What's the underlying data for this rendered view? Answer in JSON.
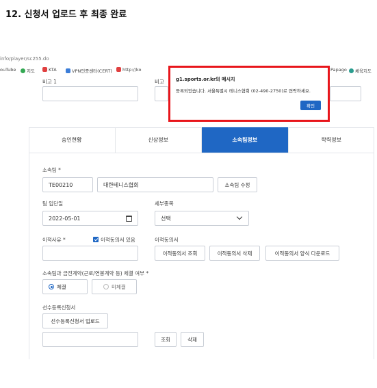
{
  "heading": "12. 신청서 업로드 후 최종 완료",
  "browser": {
    "url": "info/player/sc255.do",
    "bookmarks": [
      {
        "label": "ouTube",
        "color": "#ffffff"
      },
      {
        "label": "지도",
        "color": "#34a853"
      },
      {
        "label": "KTA",
        "color": "#e04040"
      },
      {
        "label": "VPN인증센터(CERT)",
        "color": "#3b7dd8"
      },
      {
        "label": "http://ko",
        "color": "#e04040"
      },
      {
        "label": "Papago",
        "color": "#ffffff"
      },
      {
        "label": "체육지도",
        "color": "#2a9d8f"
      }
    ]
  },
  "form": {
    "top_label_1": "비고 1",
    "top_label_2": "비고",
    "tabs": [
      "승인현황",
      "신상정보",
      "소속팀정보",
      "학력정보"
    ],
    "team_label": "소속팀 *",
    "team_code": "TE00210",
    "team_name": "대한테니스협회",
    "team_edit_button": "소속팀 수정",
    "join_date_label": "팀 입단일",
    "join_date": "2022-05-01",
    "detail_event_label": "세부종목",
    "detail_event_value": "선택",
    "transfer_reason_label": "이적사유 *",
    "transfer_consent_check": "이적동의서 있음",
    "transfer_doc_label": "이적동의서",
    "transfer_view_button": "이적동의서 조회",
    "transfer_delete_button": "이적동의서 삭제",
    "transfer_download_button": "이적동의서 양식 다운로드",
    "contract_label": "소속팀과 금전계약(근로/연봉계약 등) 체결 여부 *",
    "contract_yes": "체결",
    "contract_no": "미체결",
    "application_label": "선수등록신청서",
    "application_upload_button": "선수등록신청서 업로드",
    "application_view_button": "조회",
    "application_delete_button": "삭제"
  },
  "dialog": {
    "title": "g1.sports.or.kr의 메시지",
    "message": "등록되었습니다. 서울특별시 테니스협회 (02-490-2750)로 연락하세요.",
    "ok_button": "확인"
  }
}
